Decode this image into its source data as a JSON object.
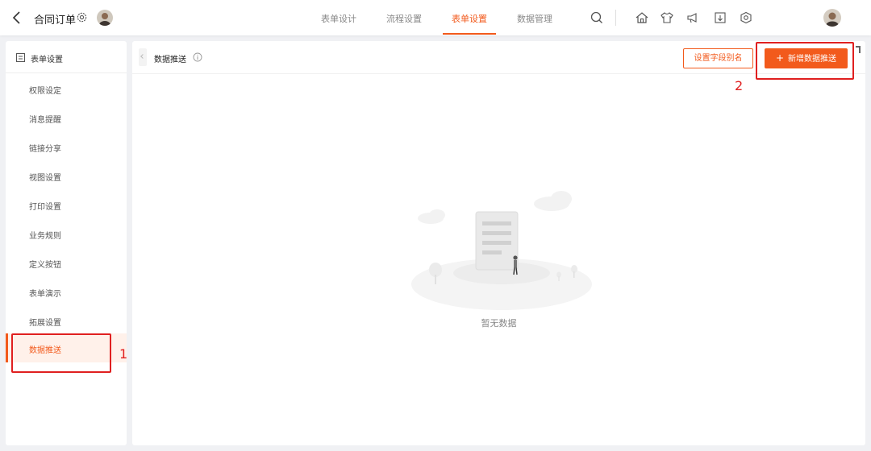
{
  "header": {
    "title": "合同订单",
    "tabs": [
      {
        "label": "表单设计",
        "active": false
      },
      {
        "label": "流程设置",
        "active": false
      },
      {
        "label": "表单设置",
        "active": true
      },
      {
        "label": "数据管理",
        "active": false
      }
    ],
    "toolbar_icons": [
      "search-icon",
      "home-icon",
      "shirt-icon",
      "megaphone-icon",
      "download-icon",
      "settings-icon"
    ]
  },
  "sidebar": {
    "header_label": "表单设置",
    "items": [
      {
        "label": "权限设定",
        "active": false
      },
      {
        "label": "消息提醒",
        "active": false
      },
      {
        "label": "链接分享",
        "active": false
      },
      {
        "label": "视图设置",
        "active": false
      },
      {
        "label": "打印设置",
        "active": false
      },
      {
        "label": "业务规则",
        "active": false
      },
      {
        "label": "定义按钮",
        "active": false
      },
      {
        "label": "表单演示",
        "active": false
      },
      {
        "label": "拓展设置",
        "active": false
      },
      {
        "label": "数据推送",
        "active": true
      }
    ]
  },
  "main": {
    "title": "数据推送",
    "alias_button_label": "设置字段别名",
    "add_button_label": "新增数据推送",
    "empty_text": "暂无数据"
  },
  "annotations": [
    {
      "label": "1"
    },
    {
      "label": "2"
    }
  ],
  "colors": {
    "accent": "#f25a1c",
    "annotation": "#e02020"
  }
}
